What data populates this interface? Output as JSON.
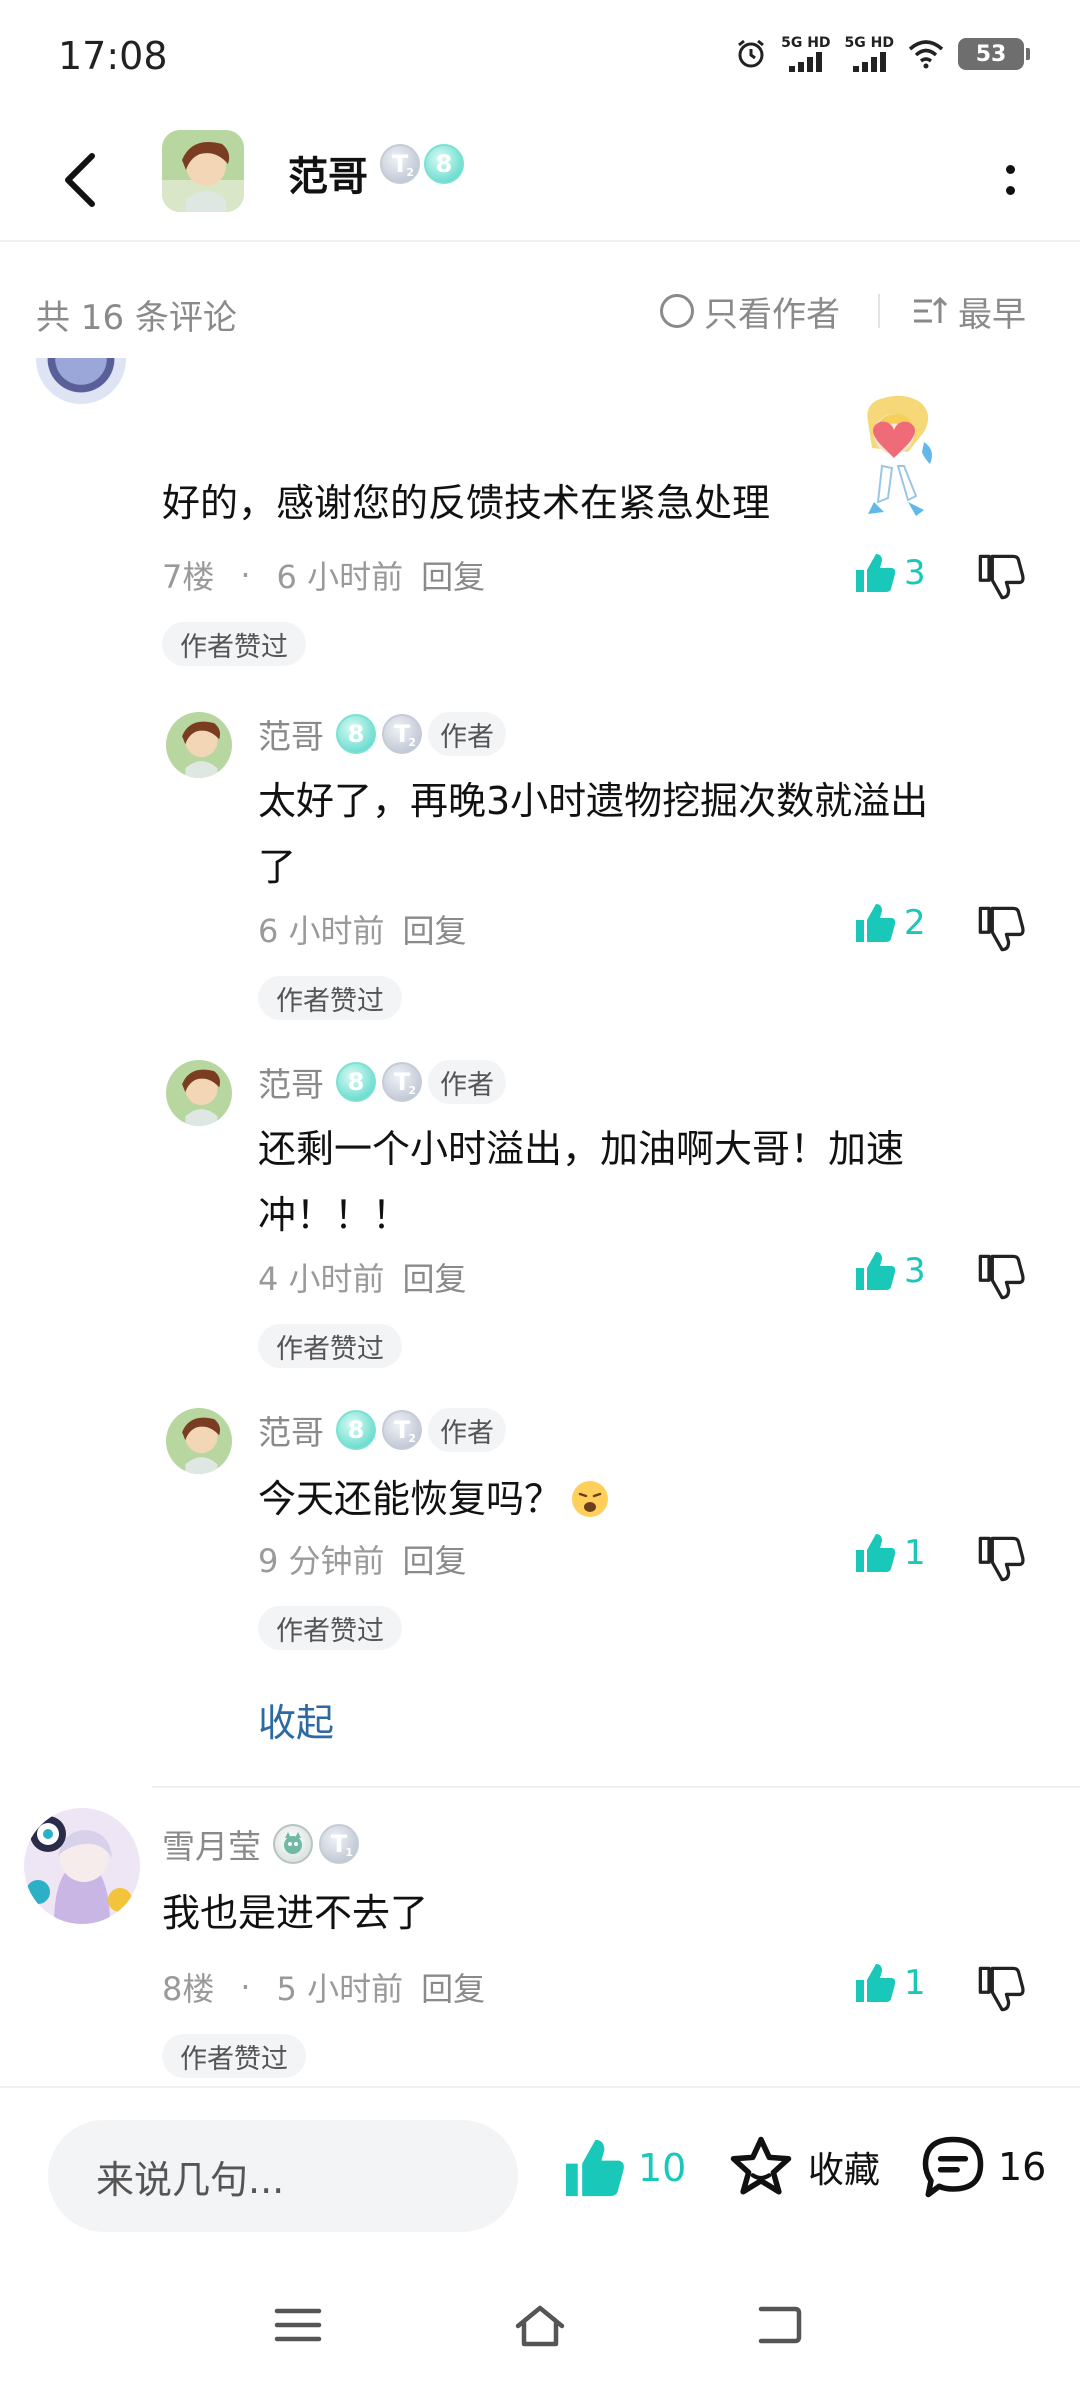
{
  "status_bar": {
    "time": "17:08",
    "network_1": "5G HD",
    "network_2": "5G HD",
    "battery": "53"
  },
  "header": {
    "title": "范哥",
    "badge_t_label": "T",
    "badge_t_level": "2",
    "badge_level": "8"
  },
  "comment_bar": {
    "count_text": "共 16 条评论",
    "author_only_label": "只看作者",
    "sort_label": "最早"
  },
  "comments": [
    {
      "text": "好的，感谢您的反馈技术在紧急处理",
      "floor": "7楼",
      "time": "6 小时前",
      "reply_label": "回复",
      "likes": "3",
      "author_liked": "作者赞过",
      "replies": [
        {
          "name": "范哥",
          "author_tag": "作者",
          "badge_level": "8",
          "badge_t_label": "T",
          "badge_t_level": "2",
          "text_line1": "太好了，再晚3小时遗物挖掘次数就溢出",
          "text_line2": "了",
          "time": "6 小时前",
          "reply_label": "回复",
          "likes": "2",
          "author_liked": "作者赞过"
        },
        {
          "name": "范哥",
          "author_tag": "作者",
          "badge_level": "8",
          "badge_t_label": "T",
          "badge_t_level": "2",
          "text_line1": "还剩一个小时溢出，加油啊大哥！加速",
          "text_line2": "冲！！！",
          "time": "4 小时前",
          "reply_label": "回复",
          "likes": "3",
          "author_liked": "作者赞过"
        },
        {
          "name": "范哥",
          "author_tag": "作者",
          "badge_level": "8",
          "badge_t_label": "T",
          "badge_t_level": "2",
          "text_line1": "今天还能恢复吗？",
          "emoji_icon": "weary-face-emoji",
          "time": "9 分钟前",
          "reply_label": "回复",
          "likes": "1",
          "author_liked": "作者赞过"
        }
      ],
      "collapse_label": "收起"
    },
    {
      "name": "雪月莹",
      "badge_t_label": "T",
      "badge_t_level": "1",
      "text": "我也是进不去了",
      "floor": "8楼",
      "time": "5 小时前",
      "reply_label": "回复",
      "likes": "1",
      "author_liked": "作者赞过"
    }
  ],
  "bottom_bar": {
    "input_placeholder": "来说几句...",
    "like_count": "10",
    "favorite_label": "收藏",
    "comment_count": "16"
  },
  "colors": {
    "accent": "#19c8b8",
    "link": "#2d6aa3",
    "muted": "#9a9a9a"
  },
  "icons": [
    "back-arrow-icon",
    "more-vertical-icon",
    "radio-circle-icon",
    "sort-ascending-icon",
    "thumbs-up-icon",
    "thumbs-down-icon",
    "star-icon",
    "comment-bubble-icon",
    "menu-icon",
    "home-icon",
    "back-nav-icon"
  ]
}
